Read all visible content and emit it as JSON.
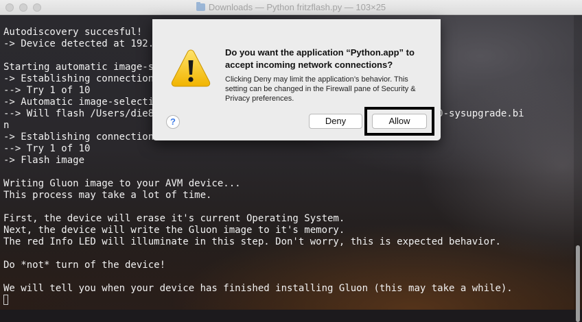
{
  "window": {
    "title": "Downloads — Python fritzflash.py — 103×25"
  },
  "terminal": {
    "lines": [
      "",
      "Autodiscovery succesful!",
      "-> Device detected at 192.16",
      "",
      "Starting automatic image-se",
      "-> Establishing connection",
      "--> Try 1 of 10",
      "-> Automatic image-selectio",
      "--> Will flash /Users/die84                                        -box-4020-sysupgrade.bi",
      "n",
      "-> Establishing connection",
      "--> Try 1 of 10",
      "-> Flash image",
      "",
      "Writing Gluon image to your AVM device...",
      "This process may take a lot of time.",
      "",
      "First, the device will erase it's current Operating System.",
      "Next, the device will write the Gluon image to it's memory.",
      "The red Info LED will illuminate in this step. Don't worry, this is expected behavior.",
      "",
      "Do *not* turn of the device!",
      "",
      "We will tell you when your device has finished installing Gluon (this may take a while).",
      ""
    ]
  },
  "dialog": {
    "title": "Do you want the application “Python.app” to accept incoming network connections?",
    "body": "Clicking Deny may limit the application’s behavior. This setting can be changed in the Firewall pane of Security & Privacy preferences.",
    "help_label": "?",
    "deny_label": "Deny",
    "allow_label": "Allow",
    "icon": "caution-icon"
  },
  "colors": {
    "dialog_bg": "#ececec",
    "terminal_text": "#f2f2f2",
    "caution_yellow": "#f5c518",
    "help_blue": "#3b7ae6",
    "highlight": "#000000"
  }
}
